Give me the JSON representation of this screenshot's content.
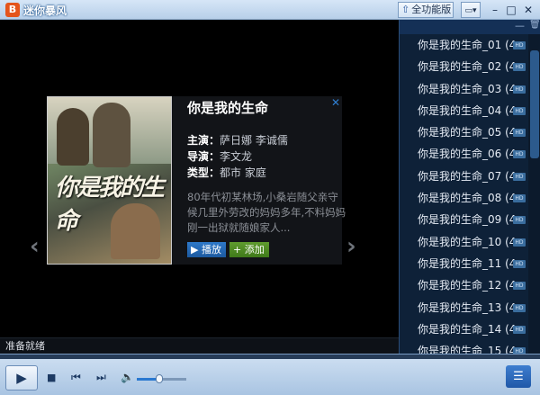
{
  "window": {
    "app_title": "迷你暴风",
    "full_version_label": "全功能版"
  },
  "movie": {
    "title": "你是我的生命",
    "poster_title": "你是我的生命",
    "cast_label": "主演：",
    "cast_value": "萨日娜 李诚儒",
    "director_label": "导演：",
    "director_value": "李文龙",
    "genre_label": "类型：",
    "genre_value": "都市 家庭",
    "description": "80年代初某林场,小桑岩随父亲守候几里外劳改的妈妈多年,不料妈妈刚一出狱就随娘家人...",
    "play_label": "播放",
    "add_label": "添加"
  },
  "status": {
    "text": "准备就绪"
  },
  "playlist": {
    "items": [
      "你是我的生命_01 (4...",
      "你是我的生命_02 (4...",
      "你是我的生命_03 (4...",
      "你是我的生命_04 (4...",
      "你是我的生命_05 (4...",
      "你是我的生命_06 (4...",
      "你是我的生命_07 (4...",
      "你是我的生命_08 (4...",
      "你是我的生命_09 (4...",
      "你是我的生命_10 (4...",
      "你是我的生命_11 (4...",
      "你是我的生命_12 (4...",
      "你是我的生命_13 (4...",
      "你是我的生命_14 (4...",
      "你是我的生命_15 (4..."
    ],
    "badge": "HD"
  },
  "controls": {
    "volume_level": 0.45
  },
  "colors": {
    "accent": "#2a78d0",
    "playlist_bg": "#0e2138"
  }
}
